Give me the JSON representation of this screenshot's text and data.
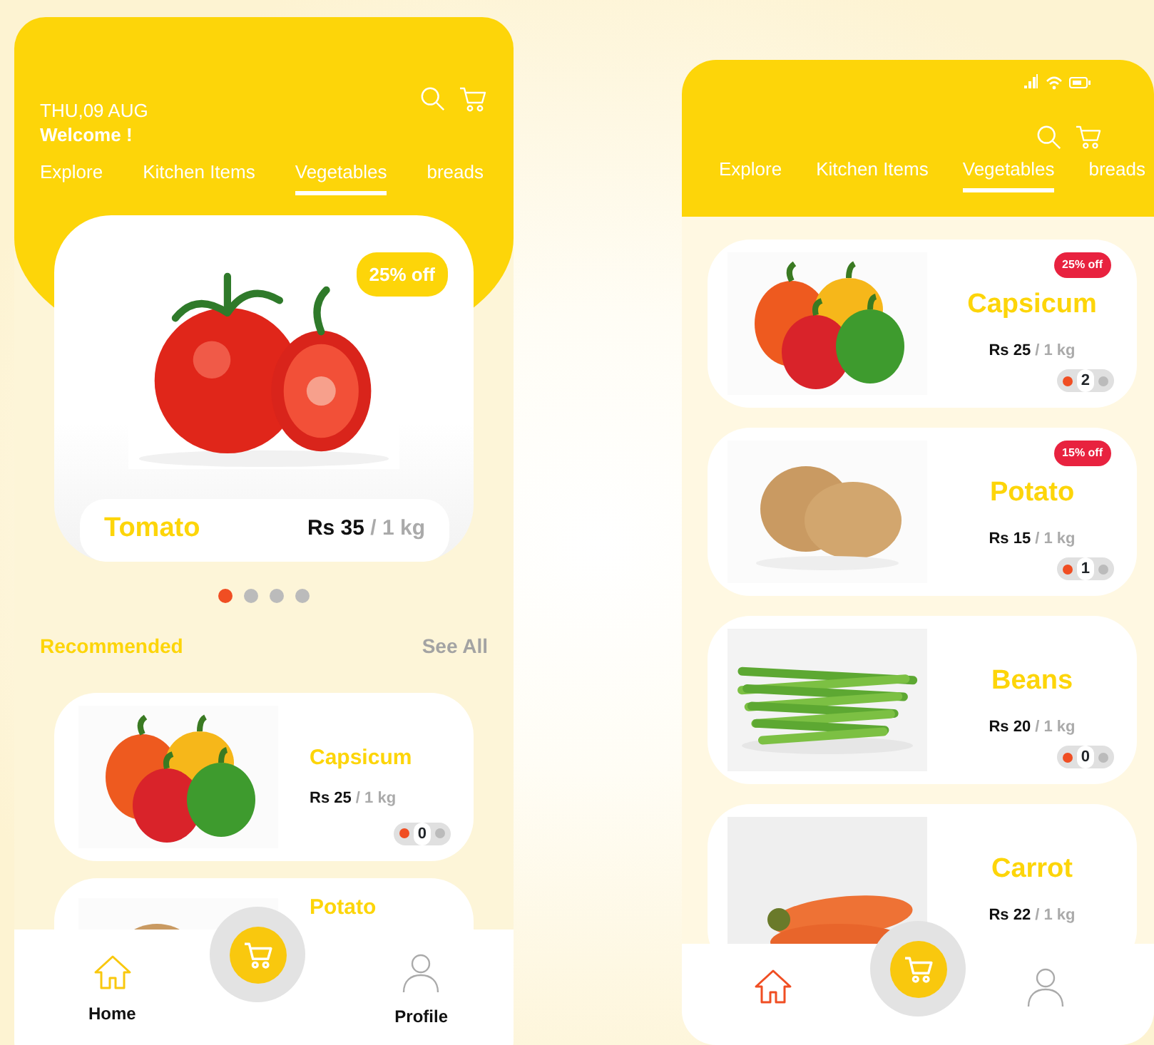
{
  "screens": [
    {
      "kind": "home",
      "date": "THU,09 AUG",
      "greeting": "Welcome !",
      "tabs": [
        {
          "label": "Explore",
          "selected": false
        },
        {
          "label": "Kitchen Items",
          "selected": false
        },
        {
          "label": "Vegetables",
          "selected": true
        },
        {
          "label": "breads",
          "selected": false
        }
      ],
      "hero": {
        "badge": "25% off",
        "name": "Tomato",
        "price": "Rs 35",
        "unit": "/ 1 kg"
      },
      "carousel_dots": [
        {
          "selected": true
        },
        {
          "selected": false
        },
        {
          "selected": false
        },
        {
          "selected": false
        }
      ],
      "section": {
        "title": "Recommended",
        "link": "See All"
      },
      "products": [
        {
          "name": "Capsicum",
          "price": "Rs 25",
          "unit": "/ 1 kg",
          "quantity": "0"
        },
        {
          "name": "Potato"
        }
      ],
      "nav": [
        {
          "label": "Home",
          "selected": true
        },
        {
          "label": "Profile",
          "selected": false
        }
      ]
    },
    {
      "kind": "list",
      "tabs": [
        {
          "label": "Explore",
          "selected": false
        },
        {
          "label": "Kitchen Items",
          "selected": false
        },
        {
          "label": "Vegetables",
          "selected": true
        },
        {
          "label": "breads",
          "selected": false
        }
      ],
      "products": [
        {
          "badge": "25% off",
          "name": "Capsicum",
          "price": "Rs 25",
          "unit": "/ 1 kg",
          "quantity": "2"
        },
        {
          "badge": "15% off",
          "name": "Potato",
          "price": "Rs 15",
          "unit": "/ 1 kg",
          "quantity": "1"
        },
        {
          "name": "Beans",
          "price": "Rs 20",
          "unit": "/ 1 kg",
          "quantity": "0"
        },
        {
          "name": "Carrot",
          "price": "Rs 22",
          "unit": "/ 1 kg"
        }
      ],
      "nav": [
        {
          "selected": true
        },
        {
          "selected": false
        }
      ]
    }
  ]
}
